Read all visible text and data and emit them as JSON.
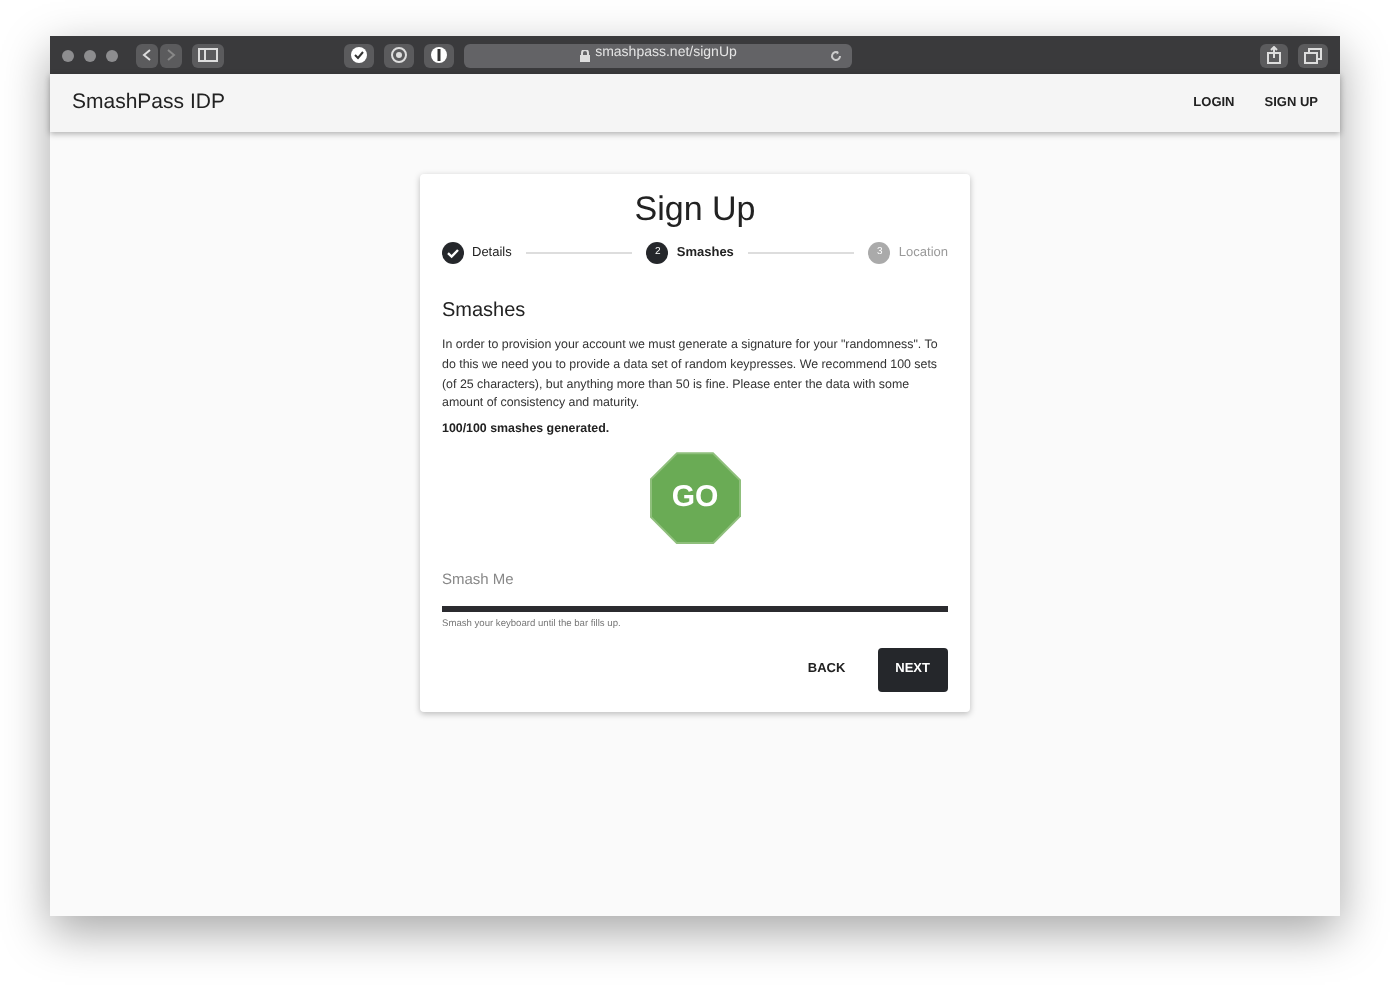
{
  "browser": {
    "url": "smashpass.net/signUp"
  },
  "app_bar": {
    "title": "SmashPass IDP",
    "links": [
      "LOGIN",
      "SIGN UP"
    ]
  },
  "card": {
    "title": "Sign Up",
    "steps": [
      {
        "label": "Details",
        "completed": true,
        "selected": false
      },
      {
        "number": "2",
        "label": "Smashes",
        "completed": false,
        "selected": true
      },
      {
        "number": "3",
        "label": "Location",
        "completed": false,
        "selected": false
      }
    ],
    "heading": "Smashes",
    "description": "In order to provision your account we must generate a signature for your \"randomness\". To do this we need you to provide a data set of random keypresses. We recommend 100 sets (of 25 characters), but anything more than 50 is fine. Please enter the data with some amount of consistency and maturity.",
    "status": "100/100 smashes generated.",
    "sign": "GO",
    "field": {
      "placeholder": "Smash Me",
      "level": 1.0,
      "hint": "Smash your keyboard until the bar fills up."
    },
    "buttons": [
      {
        "label": "BACK",
        "kind": "text"
      },
      {
        "label": "NEXT",
        "kind": "primary"
      }
    ]
  }
}
